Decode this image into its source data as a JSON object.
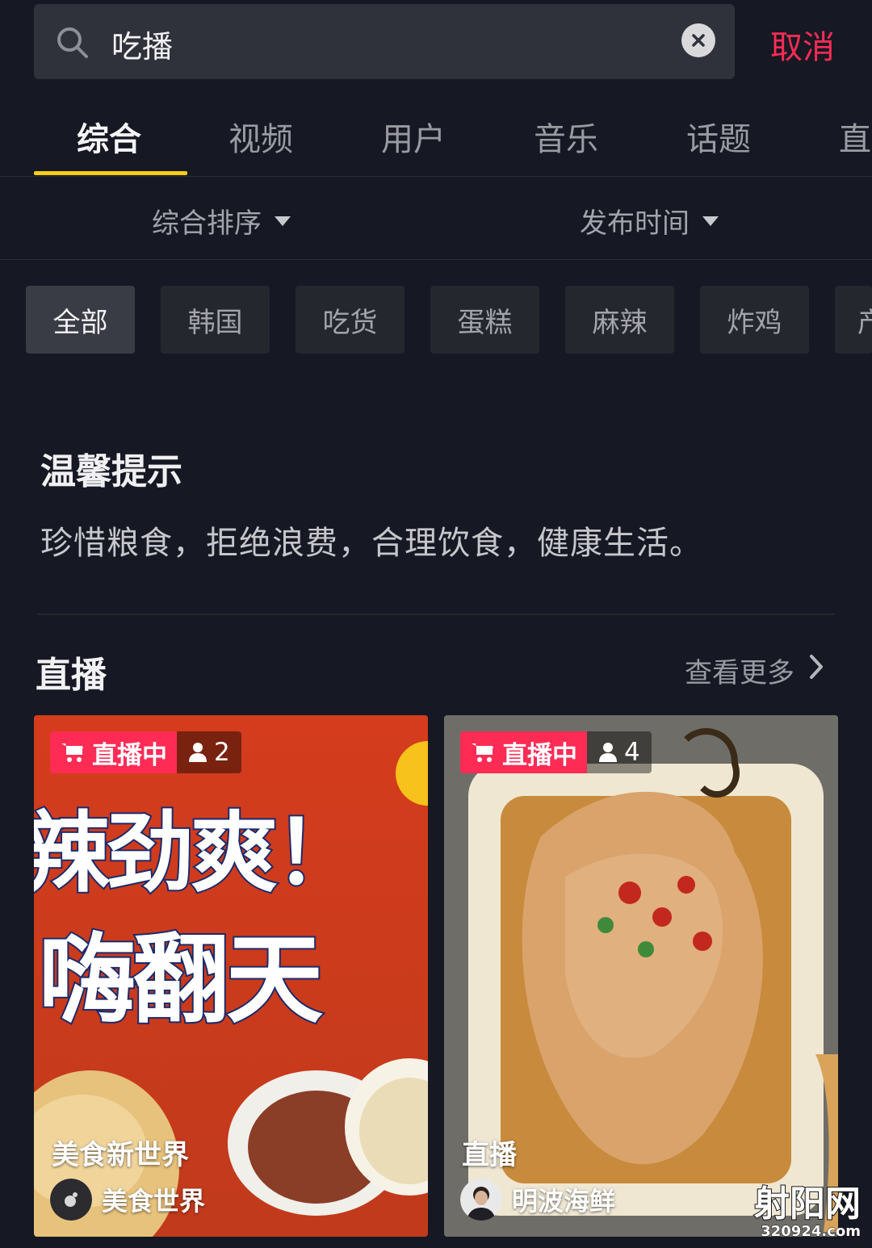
{
  "search": {
    "query": "吃播",
    "cancel_label": "取消"
  },
  "tabs": [
    {
      "label": "综合"
    },
    {
      "label": "视频"
    },
    {
      "label": "用户"
    },
    {
      "label": "音乐"
    },
    {
      "label": "话题"
    },
    {
      "label": "直"
    }
  ],
  "sort": {
    "order_label": "综合排序",
    "time_label": "发布时间"
  },
  "chips": [
    {
      "label": "全部"
    },
    {
      "label": "韩国"
    },
    {
      "label": "吃货"
    },
    {
      "label": "蛋糕"
    },
    {
      "label": "麻辣"
    },
    {
      "label": "炸鸡"
    },
    {
      "label": "产"
    }
  ],
  "tip": {
    "title": "温馨提示",
    "text": "珍惜粮食，拒绝浪费，合理饮食，健康生活。"
  },
  "live_section": {
    "title": "直播",
    "more_label": "查看更多",
    "cards": [
      {
        "status": "直播中",
        "viewers": "2",
        "title": "美食新世界",
        "author": "美食世界",
        "banner_line1": "辣劲爽！",
        "banner_line2": "嗨翻天"
      },
      {
        "status": "直播中",
        "viewers": "4",
        "title": "直播",
        "author": "明波海鲜"
      }
    ]
  },
  "watermark": {
    "main": "射阳网",
    "sub": "320924.com"
  },
  "colors": {
    "background": "#161823",
    "accent": "#fe2c55",
    "tab_indicator": "#face15"
  }
}
